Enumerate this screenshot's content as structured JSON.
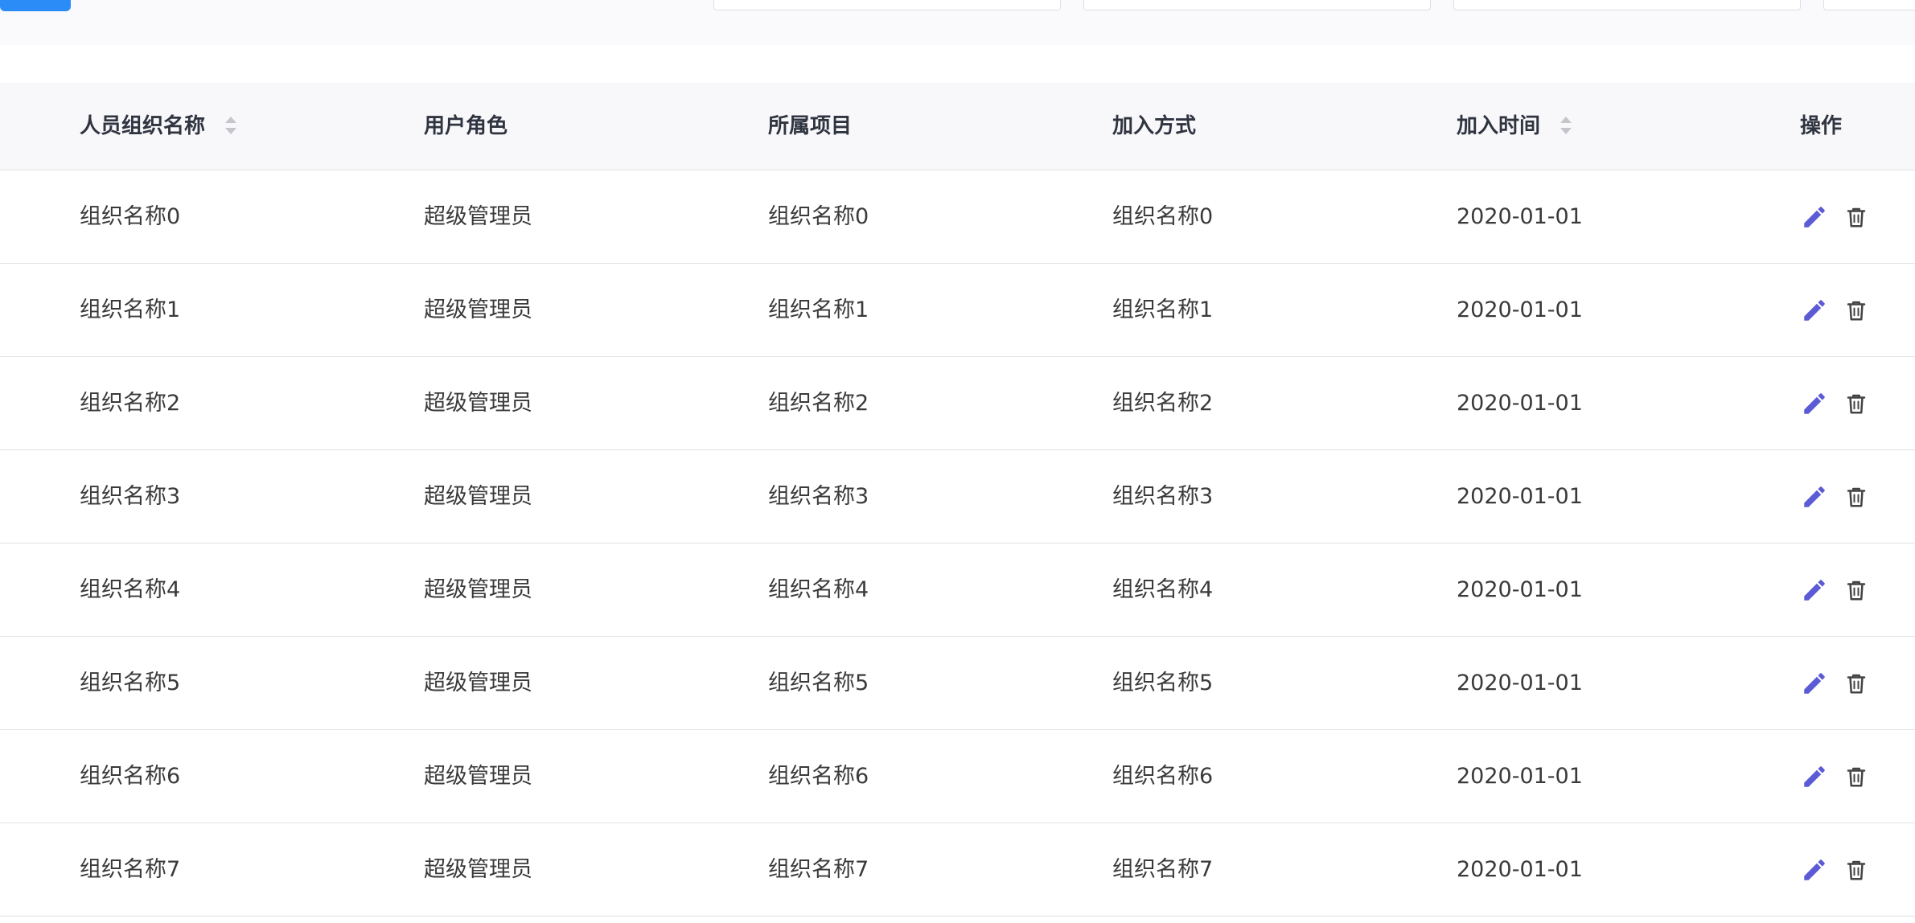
{
  "colors": {
    "primary": "#2b8cf7",
    "edit_icon": "#5b5bd6",
    "delete_icon": "#444444",
    "header_bg": "#f8f8fa",
    "border": "#e3e3e8"
  },
  "table": {
    "headers": [
      {
        "label": "人员组织名称",
        "sortable": true
      },
      {
        "label": "用户角色",
        "sortable": false
      },
      {
        "label": "所属项目",
        "sortable": false
      },
      {
        "label": "加入方式",
        "sortable": false
      },
      {
        "label": "加入时间",
        "sortable": true
      },
      {
        "label": "操作",
        "sortable": false
      }
    ],
    "rows": [
      {
        "name": "组织名称0",
        "role": "超级管理员",
        "project": "组织名称0",
        "join_method": "组织名称0",
        "join_time": "2020-01-01"
      },
      {
        "name": "组织名称1",
        "role": "超级管理员",
        "project": "组织名称1",
        "join_method": "组织名称1",
        "join_time": "2020-01-01"
      },
      {
        "name": "组织名称2",
        "role": "超级管理员",
        "project": "组织名称2",
        "join_method": "组织名称2",
        "join_time": "2020-01-01"
      },
      {
        "name": "组织名称3",
        "role": "超级管理员",
        "project": "组织名称3",
        "join_method": "组织名称3",
        "join_time": "2020-01-01"
      },
      {
        "name": "组织名称4",
        "role": "超级管理员",
        "project": "组织名称4",
        "join_method": "组织名称4",
        "join_time": "2020-01-01"
      },
      {
        "name": "组织名称5",
        "role": "超级管理员",
        "project": "组织名称5",
        "join_method": "组织名称5",
        "join_time": "2020-01-01"
      },
      {
        "name": "组织名称6",
        "role": "超级管理员",
        "project": "组织名称6",
        "join_method": "组织名称6",
        "join_time": "2020-01-01"
      },
      {
        "name": "组织名称7",
        "role": "超级管理员",
        "project": "组织名称7",
        "join_method": "组织名称7",
        "join_time": "2020-01-01"
      }
    ],
    "row_actions": [
      {
        "icon": "pencil-icon",
        "action": "edit"
      },
      {
        "icon": "trash-icon",
        "action": "delete"
      }
    ]
  }
}
